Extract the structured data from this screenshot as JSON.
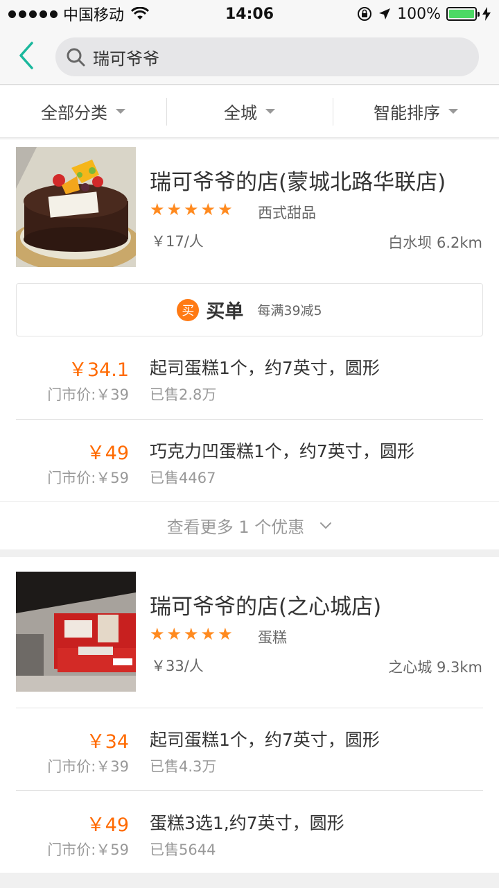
{
  "status_bar": {
    "carrier": "中国移动",
    "time": "14:06",
    "battery": "100%",
    "battery_level": 1.0
  },
  "search": {
    "query": "瑞可爷爷"
  },
  "filters": [
    {
      "label": "全部分类"
    },
    {
      "label": "全城"
    },
    {
      "label": "智能排序"
    }
  ],
  "shops": [
    {
      "name": "瑞可爷爷的店(蒙城北路华联店)",
      "rating_stars": 5,
      "category": "西式甜品",
      "avg_price": "￥17/人",
      "location": "白水坝 6.2km",
      "maidan": {
        "icon_text": "买",
        "label": "买单",
        "offer": "每满39减5"
      },
      "deals": [
        {
          "price": "￥34.1",
          "market_price": "门市价:￥39",
          "title": "起司蛋糕1个，约7英寸，圆形",
          "sold": "已售2.8万"
        },
        {
          "price": "￥49",
          "market_price": "门市价:￥59",
          "title": "巧克力凹蛋糕1个，约7英寸，圆形",
          "sold": "已售4467"
        }
      ],
      "more_text": "查看更多 1 个优惠"
    },
    {
      "name": "瑞可爷爷的店(之心城店)",
      "rating_stars": 5,
      "category": "蛋糕",
      "avg_price": "￥33/人",
      "location": "之心城 9.3km",
      "deals": [
        {
          "price": "￥34",
          "market_price": "门市价:￥39",
          "title": "起司蛋糕1个，约7英寸，圆形",
          "sold": "已售4.3万"
        },
        {
          "price": "￥49",
          "market_price": "门市价:￥59",
          "title": "蛋糕3选1,约7英寸，圆形",
          "sold": "已售5644"
        }
      ]
    }
  ],
  "colors": {
    "accent": "#1bb89d",
    "price": "#ff6a00",
    "star": "#ff8a1f"
  }
}
